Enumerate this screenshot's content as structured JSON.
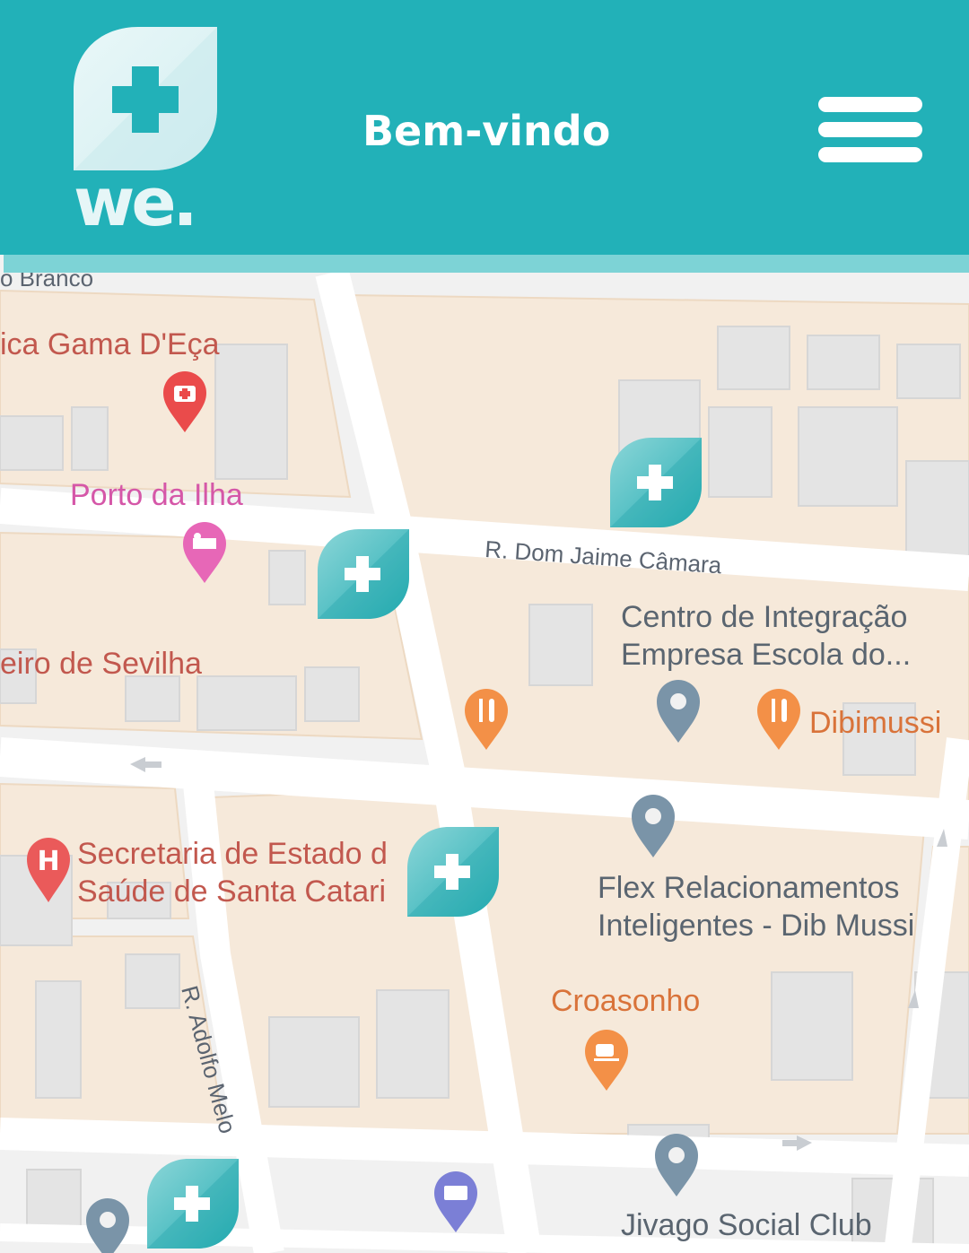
{
  "header": {
    "logo_text": "we.",
    "title": "Bem-vindo",
    "menu_icon": "hamburger-menu-icon"
  },
  "colors": {
    "header_bg": "#22b1b8",
    "header_stripe": "#7dd3d6",
    "marker_teal": "#3fb6b9"
  },
  "map": {
    "places": [
      {
        "name": "ica Gama D'Eça",
        "icon": "medical-kit-pin-icon"
      },
      {
        "name": "Porto da Ilha",
        "icon": "hotel-pin-icon"
      },
      {
        "name": "eiro de Sevilha"
      },
      {
        "name": "Secretaria de Estado d",
        "name_line2": "Saúde de Santa Catari",
        "icon": "hospital-pin-icon"
      },
      {
        "name": "Centro de Integração",
        "name_line2": "Empresa Escola do...",
        "icon": "location-pin-icon"
      },
      {
        "name": "Dibimussi",
        "icon": "restaurant-pin-icon"
      },
      {
        "name": "Flex Relacionamentos",
        "name_line2": "Inteligentes - Dib Mussi",
        "icon": "location-pin-icon"
      },
      {
        "name": "Croasonho",
        "icon": "cafe-pin-icon"
      },
      {
        "name": "Jivago Social Club",
        "icon": "location-pin-icon"
      }
    ],
    "streets": [
      "R. Dom Jaime Câmara",
      "R. Adolfo Melo",
      "o Branco"
    ]
  }
}
